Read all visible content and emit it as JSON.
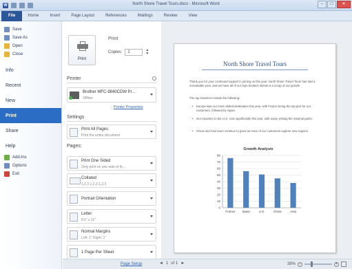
{
  "window": {
    "title": "North Shore Travel Tours.docx - Microsoft Word",
    "word_logo": "W",
    "controls": [
      "–",
      "□",
      "✕"
    ]
  },
  "ribbon_tabs": [
    "File",
    "Home",
    "Insert",
    "Page Layout",
    "References",
    "Mailings",
    "Review",
    "View"
  ],
  "nav": {
    "top_items": [
      {
        "label": "Save",
        "icon": "save-icon"
      },
      {
        "label": "Save As",
        "icon": "save-as-icon"
      },
      {
        "label": "Open",
        "icon": "open-folder-icon"
      },
      {
        "label": "Close",
        "icon": "close-folder-icon"
      }
    ],
    "categories": [
      "Info",
      "Recent",
      "New",
      "Print",
      "Share",
      "Help"
    ],
    "active": "Print",
    "help_items": [
      {
        "label": "Add-Ins",
        "icon": "add-ins-icon"
      },
      {
        "label": "Options",
        "icon": "options-icon"
      },
      {
        "label": "Exit",
        "icon": "exit-icon"
      }
    ]
  },
  "print": {
    "button_label": "Print",
    "header": "Print",
    "copies_label": "Copies:",
    "copies_value": "1"
  },
  "printer": {
    "section": "Printer",
    "name": "Brother MFC-9840CDW Pr...",
    "status": "Offline",
    "properties_link": "Printer Properties"
  },
  "settings": {
    "section": "Settings",
    "print_what": {
      "title": "Print All Pages",
      "subtitle": "Print the entire document"
    },
    "pages_label": "Pages:",
    "sides": {
      "title": "Print One Sided",
      "subtitle": "Only print on one side of th..."
    },
    "collate": {
      "title": "Collated",
      "subtitle": "1,2,3   1,2,3   1,2,3"
    },
    "orientation": {
      "title": "Portrait Orientation",
      "subtitle": ""
    },
    "paper": {
      "title": "Letter",
      "subtitle": "8.5\" x 11\""
    },
    "margins": {
      "title": "Normal Margins",
      "subtitle": "Left: 1\"   Right: 1\""
    },
    "per_sheet": {
      "title": "1 Page Per Sheet",
      "subtitle": ""
    },
    "page_setup_link": "Page Setup"
  },
  "preview": {
    "doc_title": "North Shore Travel Tours",
    "para1": "Thank you for your continued support in joining us this year. North Shore Travel Tours has had a remarkable year, and we have all of our trips booked. Below is a recap of our growth.",
    "para2": "The top travelers include the following:",
    "bullets": [
      "Europe was our most visited destination this year, with France being the top pick for our customers, followed by Spain.",
      "Our travelers to the U.S. rose significantly this year, with many visiting the national parks.",
      "China and Asia tours continue to grow as more of our customers explore new regions."
    ]
  },
  "chart_data": {
    "type": "bar",
    "title": "Growth Analysis",
    "categories": [
      "France",
      "Spain",
      "U.S.",
      "China",
      "Asia"
    ],
    "values": [
      76,
      56,
      51,
      45,
      38
    ],
    "ylim": [
      0,
      80
    ],
    "yticks": [
      0,
      10,
      20,
      30,
      40,
      50,
      60,
      70,
      80
    ],
    "grid": true,
    "bar_color": "#4f81bd"
  },
  "statusbar": {
    "prev": "◄",
    "page_current": "1",
    "page_of": "of 1",
    "next": "►",
    "zoom": "38%",
    "zoom_minus": "–",
    "zoom_plus": "+"
  },
  "colors": {
    "accent": "#2b579a",
    "active_nav": "#2b6cc4",
    "link": "#3365b8"
  }
}
